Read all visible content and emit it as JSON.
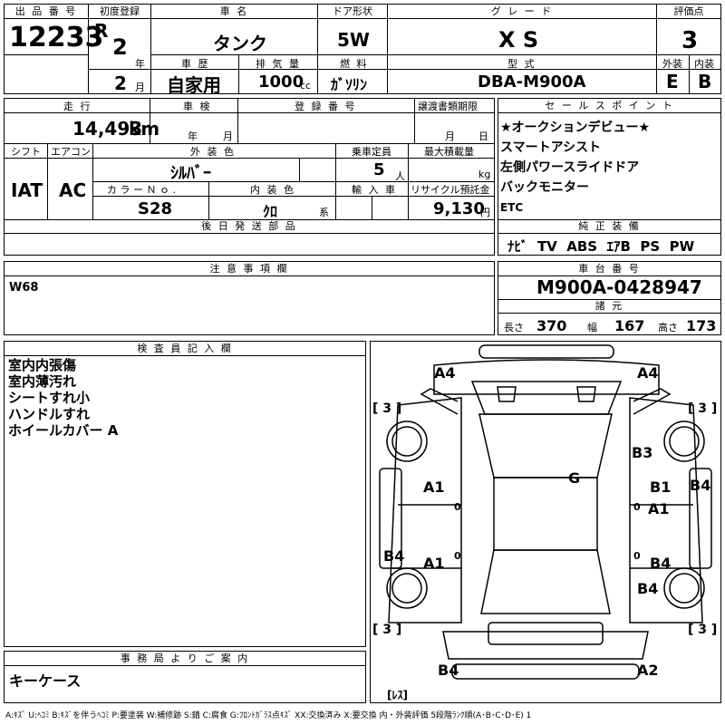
{
  "lot": {
    "label": "出 品 番 号",
    "value": "12233"
  },
  "reg": {
    "label": "初度登録",
    "era": "R",
    "year": "2",
    "year_unit": "年",
    "month": "2",
    "month_unit": "月"
  },
  "car_name": {
    "label": "車 名",
    "value": "タンク"
  },
  "door": {
    "label": "ドア形状",
    "value": "5W"
  },
  "grade": {
    "label": "グ レ ー ド",
    "value": "X S"
  },
  "score": {
    "label": "評価点",
    "value": "3"
  },
  "history": {
    "label": "車 歴",
    "value": "自家用"
  },
  "displacement": {
    "label": "排 気 量",
    "value": "1000",
    "unit": "cc"
  },
  "fuel": {
    "label": "燃 料",
    "value": "ｶﾞｿﾘﾝ"
  },
  "model": {
    "label": "型 式",
    "value": "DBA-M900A"
  },
  "exterior": {
    "label": "外装",
    "value": "E"
  },
  "interior": {
    "label": "内装",
    "value": "B"
  },
  "mileage": {
    "label": "走 行",
    "value": "14,493",
    "unit": "km"
  },
  "inspection": {
    "label": "車 検",
    "year_unit": "年",
    "month_unit": "月"
  },
  "plate": {
    "label": "登 録 番 号"
  },
  "transfer": {
    "label": "譲渡書類期限",
    "month_unit": "月",
    "day_unit": "日"
  },
  "shift": {
    "label": "シフト",
    "value": "IAT"
  },
  "aircon": {
    "label": "エアコン",
    "value": "AC"
  },
  "ext_color": {
    "label": "外 装 色",
    "value": "ｼﾙﾊﾞｰ"
  },
  "capacity": {
    "label": "乗車定員",
    "value": "5",
    "unit": "人"
  },
  "max_load": {
    "label": "最大積載量",
    "unit": "kg"
  },
  "color_no": {
    "label": "カ ラ ー Ｎ ｏ .",
    "value": "S28"
  },
  "int_color": {
    "label": "内 装 色",
    "value": "ｸﾛ",
    "unit": "系"
  },
  "import": {
    "label": "輸 入 車"
  },
  "recycle": {
    "label": "リサイクル預託金",
    "value": "9,130",
    "unit": "円"
  },
  "later_parts": {
    "label": "後 日 発 送 部 品"
  },
  "sales_points": {
    "label": "セ ー ル ス ポ イ ン ト",
    "items": [
      "★オークションデビュー★",
      "スマートアシスト",
      "左側パワースライドドア",
      "バックモニター",
      "ETC"
    ]
  },
  "equipment": {
    "label": "純 正 装 備",
    "value": "ﾅﾋﾞ  TV  ABS  ｴｱB  PS  PW"
  },
  "notes": {
    "label": "注 意 事 項 欄",
    "value": "W68"
  },
  "chassis": {
    "label": "車 台 番 号",
    "value": "M900A-0428947"
  },
  "specs": {
    "label": "諸 元",
    "length_label": "長さ",
    "length": "370",
    "width_label": "幅",
    "width": "167",
    "height_label": "高さ",
    "height": "173"
  },
  "inspector": {
    "label": "検 査 員 記 入 欄",
    "items": [
      "室内内張傷",
      "室内薄汚れ",
      "シートすれ小",
      "ハンドルすれ",
      "ホイールカバー A"
    ]
  },
  "office": {
    "label": "事 務 局 よ り ご 案 内",
    "value": "キーケース"
  },
  "legend": "A:ｷｽﾞ U:ﾍｺﾐ B:ｷｽﾞを伴うﾍｺﾐ P:要塗装 W:補修跡 S:錆 C:腐食 G:ﾌﾛﾝﾄｶﾞﾗｽ点ｷｽﾞ XX:交換済み X:要交換 内・外装評価 5段階ﾗﾝｸ順(A･B･C･D･E) 1",
  "diagram": {
    "marks": [
      "A4",
      "A4",
      "B3",
      "G",
      "A1",
      "B1",
      "B4",
      "A1",
      "A1",
      "B4",
      "B4",
      "B4",
      "B4",
      "A2"
    ],
    "tires": [
      "[ 3 ]",
      "[ 3 ]",
      "[ 3 ]",
      "[ 3 ]"
    ],
    "spare": "[ﾚｽ]",
    "zero": "0"
  }
}
